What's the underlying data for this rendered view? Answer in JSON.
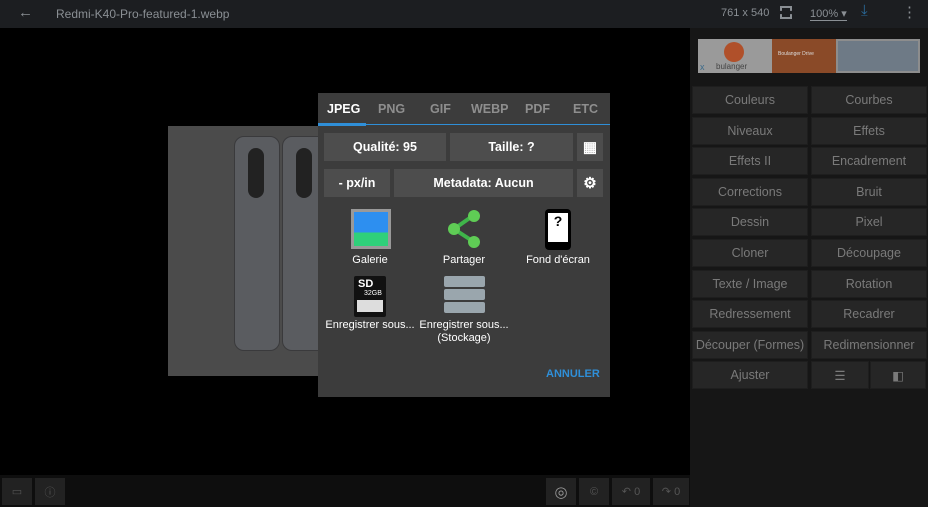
{
  "topbar": {
    "title": "Redmi-K40-Pro-featured-1.webp",
    "dimensions": "761 x 540",
    "zoom": "100%"
  },
  "ad": {
    "brand": "bulanger",
    "tagline": "Boulanger Drive"
  },
  "tools": [
    [
      "Couleurs",
      "Courbes"
    ],
    [
      "Niveaux",
      "Effets"
    ],
    [
      "Effets II",
      "Encadrement"
    ],
    [
      "Corrections",
      "Bruit"
    ],
    [
      "Dessin",
      "Pixel"
    ],
    [
      "Cloner",
      "Découpage"
    ],
    [
      "Texte / Image",
      "Rotation"
    ],
    [
      "Redressement",
      "Recadrer"
    ],
    [
      "Découper (Formes)",
      "Redimensionner"
    ],
    [
      "Ajuster"
    ]
  ],
  "dialog": {
    "tabs": [
      "JPEG",
      "PNG",
      "GIF",
      "WEBP",
      "PDF",
      "ETC"
    ],
    "active_tab": "JPEG",
    "quality": "Qualité: 95",
    "size": "Taille: ?",
    "density": "- px/in",
    "metadata": "Metadata: Aucun",
    "options": [
      "Galerie",
      "Partager",
      "Fond d'écran",
      "Enregistrer sous...",
      "Enregistrer sous... (Stockage)"
    ],
    "cancel": "ANNULER",
    "accent": "#2f8fd8"
  },
  "bottombar": {
    "undo_count": "0",
    "redo_count": "0"
  }
}
